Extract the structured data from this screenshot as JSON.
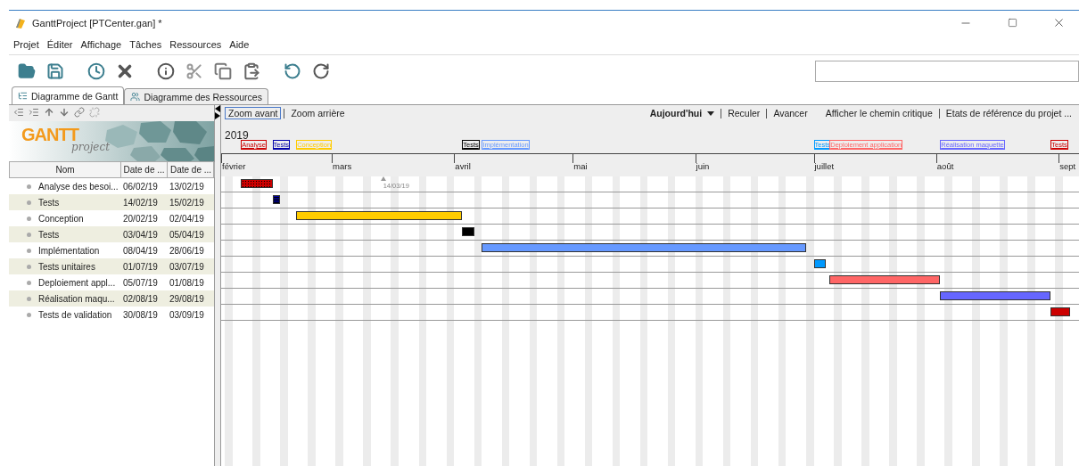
{
  "window": {
    "title": "GanttProject [PTCenter.gan] *"
  },
  "menu": [
    "Projet",
    "Éditer",
    "Affichage",
    "Tâches",
    "Ressources",
    "Aide"
  ],
  "tabs": [
    {
      "label": "Diagramme de Gantt",
      "selected": true
    },
    {
      "label": "Diagramme des Ressources",
      "selected": false
    }
  ],
  "logo": {
    "title": "GANTT",
    "subtitle": "project"
  },
  "columns": [
    "Nom",
    "Date de ...",
    "Date de ..."
  ],
  "chart_toolbar": {
    "zoom_in": "Zoom avant",
    "zoom_out": "Zoom arrière",
    "today": "Aujourd'hui",
    "back": "Reculer",
    "forward": "Avancer",
    "critical": "Afficher le chemin critique",
    "baselines": "Etats de référence du projet ..."
  },
  "timeline": {
    "year": "2019",
    "months": [
      "février",
      "mars",
      "avril",
      "mai",
      "juin",
      "juillet",
      "août",
      "sept"
    ],
    "today": "14/03/19"
  },
  "tasks": [
    {
      "name": "Analyse des besoi...",
      "start": "06/02/19",
      "end": "13/02/19",
      "color": "#cc0000",
      "kind": "dotted",
      "timeline_label": "Analyse"
    },
    {
      "name": "Tests",
      "start": "14/02/19",
      "end": "15/02/19",
      "color": "#0000aa",
      "kind": "striped",
      "timeline_label": "Tests"
    },
    {
      "name": "Conception",
      "start": "20/02/19",
      "end": "02/04/19",
      "color": "#ffcc00",
      "kind": "plain",
      "timeline_label": "Conception"
    },
    {
      "name": "Tests",
      "start": "03/04/19",
      "end": "05/04/19",
      "color": "#000000",
      "kind": "plain",
      "timeline_label": "Tests"
    },
    {
      "name": "Implémentation",
      "start": "08/04/19",
      "end": "28/06/19",
      "color": "#6699ff",
      "kind": "plain",
      "timeline_label": "Implémentation"
    },
    {
      "name": "Tests unitaires",
      "start": "01/07/19",
      "end": "03/07/19",
      "color": "#0099ff",
      "kind": "plain",
      "timeline_label": "Tests"
    },
    {
      "name": "Deploiement appl...",
      "start": "05/07/19",
      "end": "01/08/19",
      "color": "#ff6666",
      "kind": "plain",
      "timeline_label": "Deploiement application"
    },
    {
      "name": "Réalisation maqu...",
      "start": "02/08/19",
      "end": "29/08/19",
      "color": "#6666ff",
      "kind": "plain",
      "timeline_label": "Réalisation maquette"
    },
    {
      "name": "Tests de validation",
      "start": "30/08/19",
      "end": "03/09/19",
      "color": "#cc0000",
      "kind": "plain",
      "timeline_label": "Tests"
    }
  ]
}
